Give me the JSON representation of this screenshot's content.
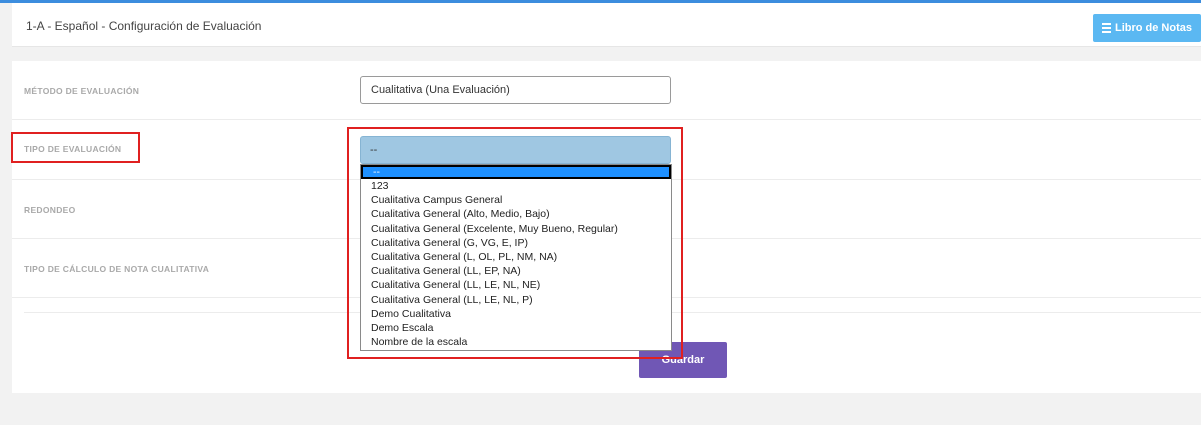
{
  "header": {
    "title": "1-A - Español - Configuración de Evaluación",
    "libro_button": "Libro de Notas"
  },
  "form": {
    "rows": [
      {
        "label": "MÉTODO DE EVALUACIÓN",
        "value": "Cualitativa (Una Evaluación)"
      },
      {
        "label": "TIPO DE EVALUACIÓN",
        "value": "--"
      },
      {
        "label": "REDONDEO"
      },
      {
        "label": "TIPO DE CÁLCULO DE NOTA CUALITATIVA"
      }
    ],
    "tipo_options": [
      "--",
      "123",
      "Cualitativa Campus General",
      "Cualitativa General (Alto, Medio, Bajo)",
      "Cualitativa General (Excelente, Muy Bueno, Regular)",
      "Cualitativa General (G, VG, E, IP)",
      "Cualitativa General (L, OL, PL, NM, NA)",
      "Cualitativa General (LL, EP, NA)",
      "Cualitativa General (LL, LE, NL, NE)",
      "Cualitativa General (LL, LE, NL, P)",
      "Demo Cualitativa",
      "Demo Escala",
      "Nombre de la escala"
    ],
    "save_button": "Guardar"
  },
  "colors": {
    "accent_blue": "#5bb8f2",
    "primary_purple": "#7057b5",
    "highlight_red": "#e02020",
    "option_selected": "#1e90ff"
  },
  "icons": {
    "libro_icon": "bars-icon"
  }
}
